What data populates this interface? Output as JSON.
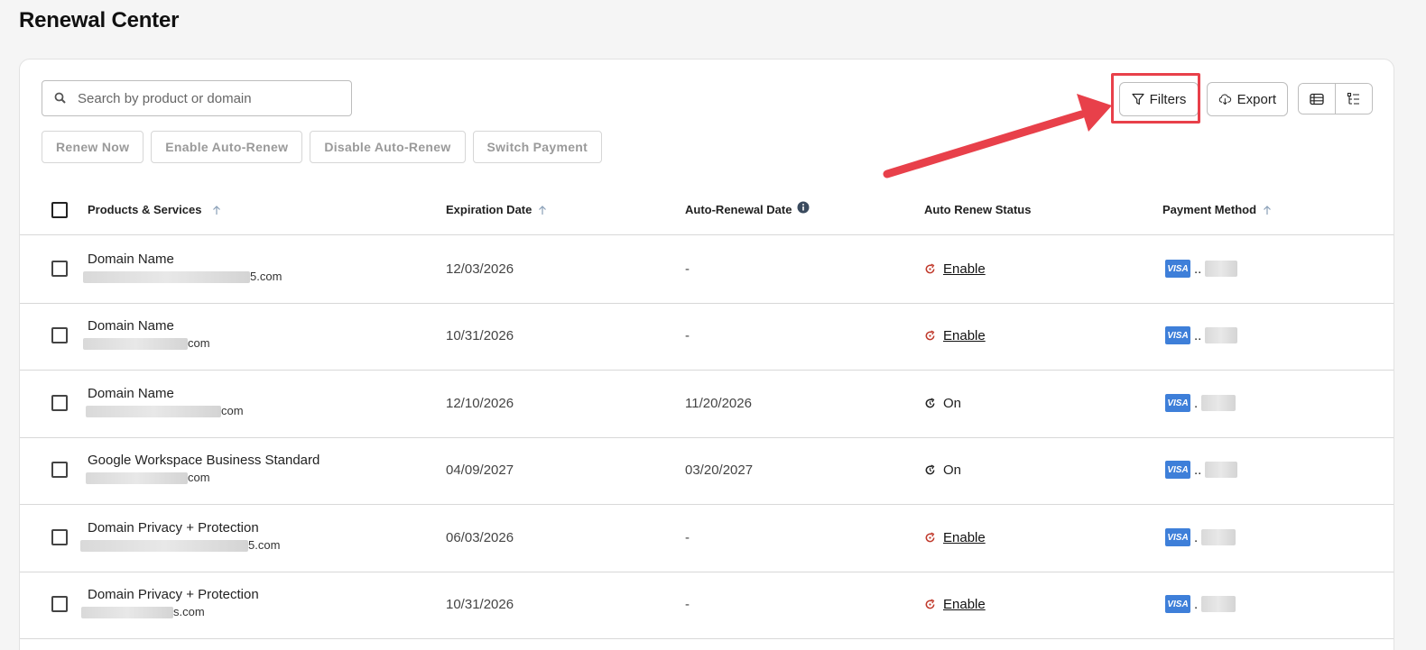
{
  "page": {
    "title": "Renewal Center"
  },
  "search": {
    "placeholder": "Search by product or domain"
  },
  "actions": {
    "renew_now": "Renew Now",
    "enable_auto_renew": "Enable Auto-Renew",
    "disable_auto_renew": "Disable Auto-Renew",
    "switch_payment": "Switch Payment"
  },
  "toolbar": {
    "filters_label": "Filters",
    "export_label": "Export"
  },
  "table": {
    "columns": {
      "products": "Products & Services",
      "expiration": "Expiration Date",
      "auto_renewal": "Auto-Renewal Date",
      "status": "Auto Renew Status",
      "payment": "Payment Method"
    },
    "rows": [
      {
        "product": "Domain Name",
        "domain_suffix": "5.com",
        "expiration": "12/03/2026",
        "auto_renewal": "-",
        "status": "Enable",
        "payment_brand": "VISA",
        "payment_masked": ".."
      },
      {
        "product": "Domain Name",
        "domain_suffix": "com",
        "expiration": "10/31/2026",
        "auto_renewal": "-",
        "status": "Enable",
        "payment_brand": "VISA",
        "payment_masked": ".."
      },
      {
        "product": "Domain Name",
        "domain_suffix": "com",
        "expiration": "12/10/2026",
        "auto_renewal": "11/20/2026",
        "status": "On",
        "payment_brand": "VISA",
        "payment_masked": "."
      },
      {
        "product": "Google Workspace Business Standard",
        "domain_suffix": "com",
        "expiration": "04/09/2027",
        "auto_renewal": "03/20/2027",
        "status": "On",
        "payment_brand": "VISA",
        "payment_masked": ".."
      },
      {
        "product": "Domain Privacy + Protection",
        "domain_suffix": "5.com",
        "expiration": "06/03/2026",
        "auto_renewal": "-",
        "status": "Enable",
        "payment_brand": "VISA",
        "payment_masked": "."
      },
      {
        "product": "Domain Privacy + Protection",
        "domain_suffix": "s.com",
        "expiration": "10/31/2026",
        "auto_renewal": "-",
        "status": "Enable",
        "payment_brand": "VISA",
        "payment_masked": "."
      }
    ]
  },
  "colors": {
    "accent_red": "#e8404a",
    "status_off": "#c0392b",
    "visa_blue": "#3e7fd9"
  }
}
